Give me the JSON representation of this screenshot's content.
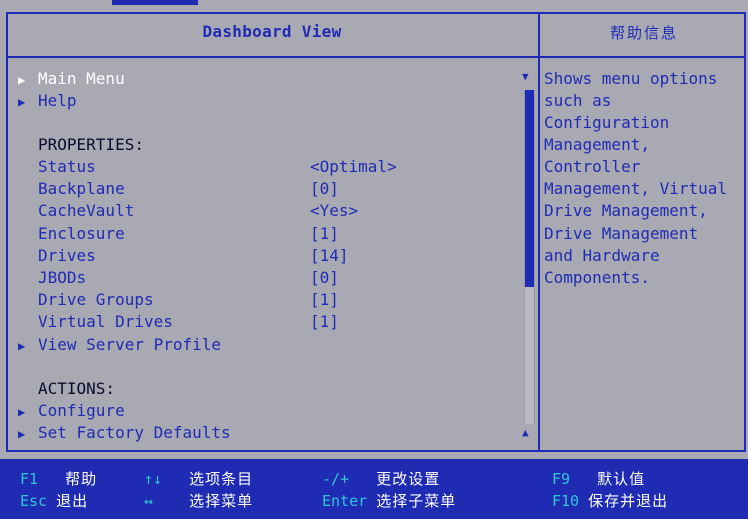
{
  "header": {
    "title": "Dashboard View",
    "help_title": "帮助信息"
  },
  "menu": {
    "main_menu": "Main Menu",
    "help": "Help",
    "properties_heading": "PROPERTIES:",
    "properties": [
      {
        "label": "Status",
        "value": "<Optimal>"
      },
      {
        "label": "Backplane",
        "value": "[0]"
      },
      {
        "label": "CacheVault",
        "value": "<Yes>"
      },
      {
        "label": "Enclosure",
        "value": "[1]"
      },
      {
        "label": "Drives",
        "value": "[14]"
      },
      {
        "label": "JBODs",
        "value": "[0]"
      },
      {
        "label": "Drive Groups",
        "value": "[1]"
      },
      {
        "label": "Virtual Drives",
        "value": "[1]"
      }
    ],
    "view_server_profile": "View Server Profile",
    "actions_heading": "ACTIONS:",
    "configure": "Configure",
    "set_factory_defaults": "Set Factory Defaults",
    "arrow_glyph": "▶",
    "scroll_up_glyph": "▼",
    "scroll_down_glyph": "▲",
    "scroll_position": 0.59
  },
  "help_panel": {
    "lines": [
      "Shows menu options",
      "such as",
      "Configuration",
      "Management,",
      "Controller",
      "Management, Virtual",
      "Drive Management,",
      "Drive Management",
      "and Hardware",
      "Components."
    ]
  },
  "footer": {
    "f1_key": "F1",
    "f1_desc": "帮助",
    "updown_key": "↑↓",
    "updown_desc": "选项条目",
    "plusminus_key": "-/+",
    "plusminus_desc": "更改设置",
    "f9_key": "F9",
    "f9_desc": "默认值",
    "esc_key": "Esc",
    "esc_desc": "退出",
    "leftright_key": "↔",
    "leftright_desc": "选择菜单",
    "enter_key": "Enter",
    "enter_desc": "选择子菜单",
    "f10_key": "F10",
    "f10_desc": "保存并退出"
  },
  "colors": {
    "background": "#a9a9b4",
    "accent": "#1f2bb2",
    "selected_text": "#ffffff",
    "footer_key": "#2fc6d6"
  }
}
